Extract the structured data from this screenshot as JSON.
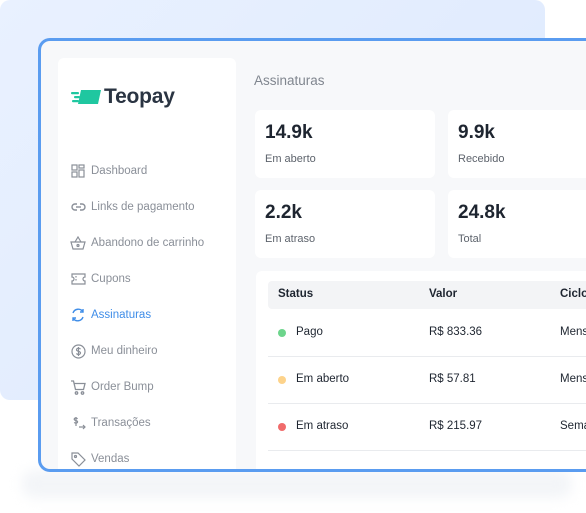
{
  "brand": {
    "name": "Teopay",
    "accent": "#1fc7a0"
  },
  "sidebar": {
    "items": [
      {
        "label": "Dashboard",
        "icon": "dashboard-icon",
        "active": false
      },
      {
        "label": "Links de pagamento",
        "icon": "link-icon",
        "active": false
      },
      {
        "label": "Abandono de carrinho",
        "icon": "basket-icon",
        "active": false
      },
      {
        "label": "Cupons",
        "icon": "ticket-icon",
        "active": false
      },
      {
        "label": "Assinaturas",
        "icon": "refresh-icon",
        "active": true
      },
      {
        "label": "Meu dinheiro",
        "icon": "dollar-icon",
        "active": false
      },
      {
        "label": "Order Bump",
        "icon": "cart-icon",
        "active": false
      },
      {
        "label": "Transações",
        "icon": "transfer-icon",
        "active": false
      },
      {
        "label": "Vendas",
        "icon": "tag-icon",
        "active": false
      }
    ]
  },
  "main": {
    "title": "Assinaturas",
    "stats": [
      {
        "value": "14.9k",
        "label": "Em aberto"
      },
      {
        "value": "9.9k",
        "label": "Recebido"
      },
      {
        "value": "2.2k",
        "label": "Em atraso"
      },
      {
        "value": "24.8k",
        "label": "Total"
      }
    ],
    "table": {
      "columns": [
        "Status",
        "Valor",
        "Ciclo"
      ],
      "rows": [
        {
          "status": "Pago",
          "status_color": "#6dd58c",
          "valor": "R$ 833.36",
          "ciclo": "Mensal"
        },
        {
          "status": "Em aberto",
          "status_color": "#fdd38b",
          "valor": "R$ 57.81",
          "ciclo": "Mensal"
        },
        {
          "status": "Em atraso",
          "status_color": "#f06b6b",
          "valor": "R$ 215.97",
          "ciclo": "Semanal"
        }
      ]
    }
  }
}
